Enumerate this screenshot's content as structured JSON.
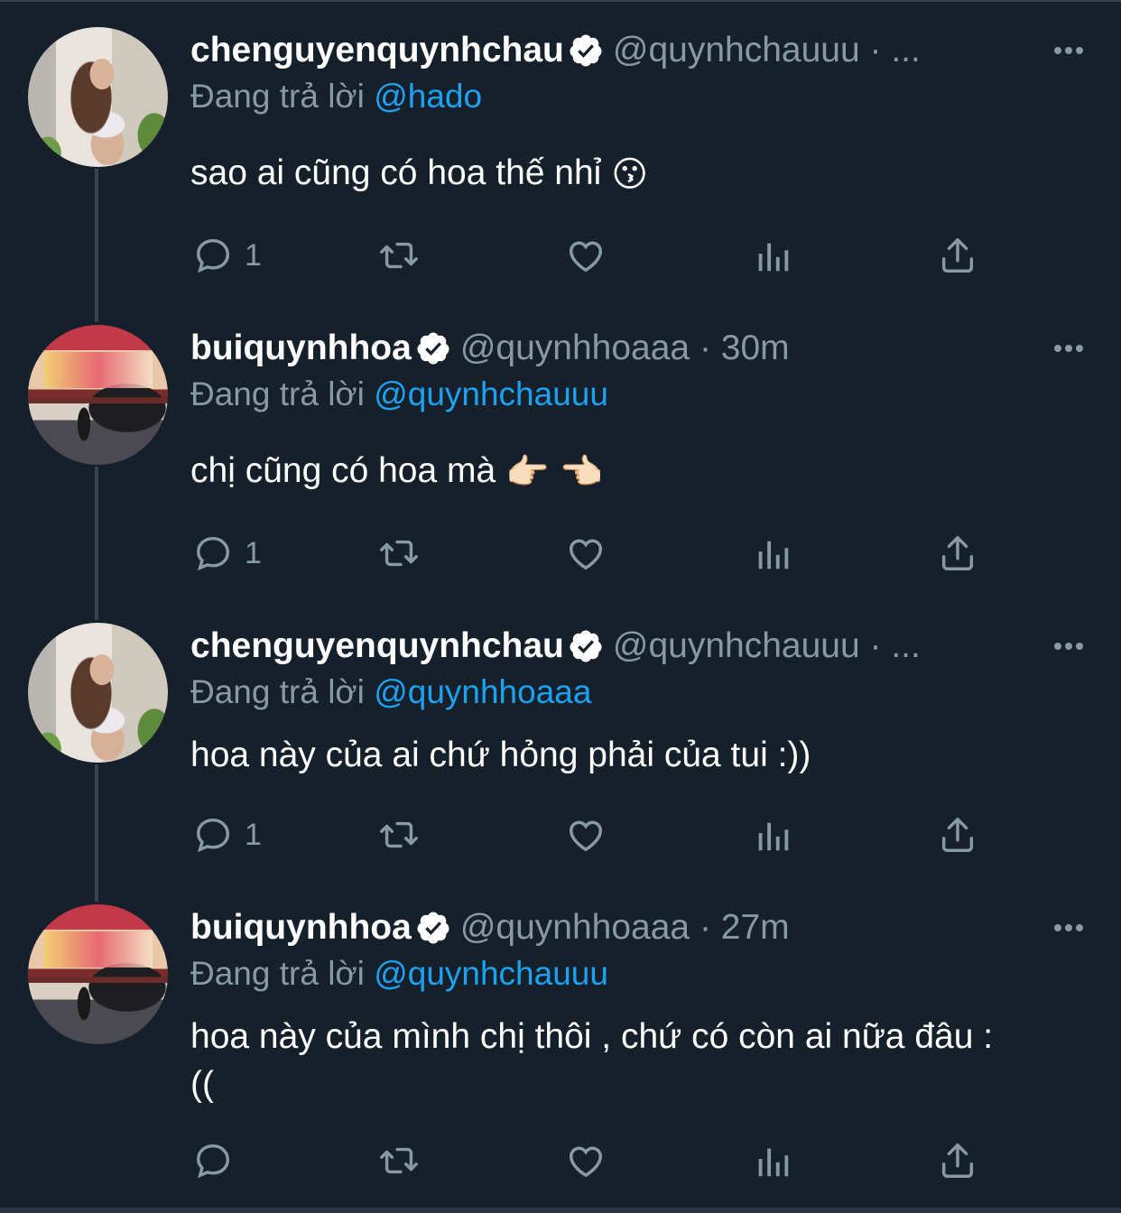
{
  "colors": {
    "background": "#15202b",
    "text": "#ffffff",
    "muted": "#8899a6",
    "link": "#1da1f2",
    "thread_line": "#38444d"
  },
  "tweets": [
    {
      "display_name": "chenguyenquynhchau",
      "handle_line": "@quynhchauuu · ...",
      "reply_prefix": "Đang trả lời",
      "reply_mention": "@hado",
      "text": "sao ai cũng có hoa thế nhỉ",
      "emoji": "😗",
      "reply_count": "1",
      "avatar": "avatar-photo-woman"
    },
    {
      "display_name": "buiquynhhoa",
      "handle_line": "@quynhhoaaa · 30m",
      "reply_prefix": "Đang trả lời",
      "reply_mention": "@quynhchauuu",
      "text": "chị cũng có hoa mà",
      "emoji": "👉🏻 👈🏻",
      "reply_count": "1",
      "avatar": "avatar-photo-street"
    },
    {
      "display_name": "chenguyenquynhchau",
      "handle_line": "@quynhchauuu · ...",
      "reply_prefix": "Đang trả lời",
      "reply_mention": "@quynhhoaaa",
      "text": "hoa này của ai chứ hỏng phải của tui :))",
      "emoji": "",
      "reply_count": "1",
      "avatar": "avatar-photo-woman"
    },
    {
      "display_name": "buiquynhhoa",
      "handle_line": "@quynhhoaaa · 27m",
      "reply_prefix": "Đang trả lời",
      "reply_mention": "@quynhchauuu",
      "text": "hoa này của mình chị thôi , chứ có còn ai nữa đâu :((",
      "emoji": "",
      "reply_count": "",
      "avatar": "avatar-photo-street"
    }
  ],
  "icons": [
    "reply-icon",
    "retweet-icon",
    "like-icon",
    "analytics-icon",
    "share-icon",
    "more-icon",
    "verified-badge-icon"
  ]
}
